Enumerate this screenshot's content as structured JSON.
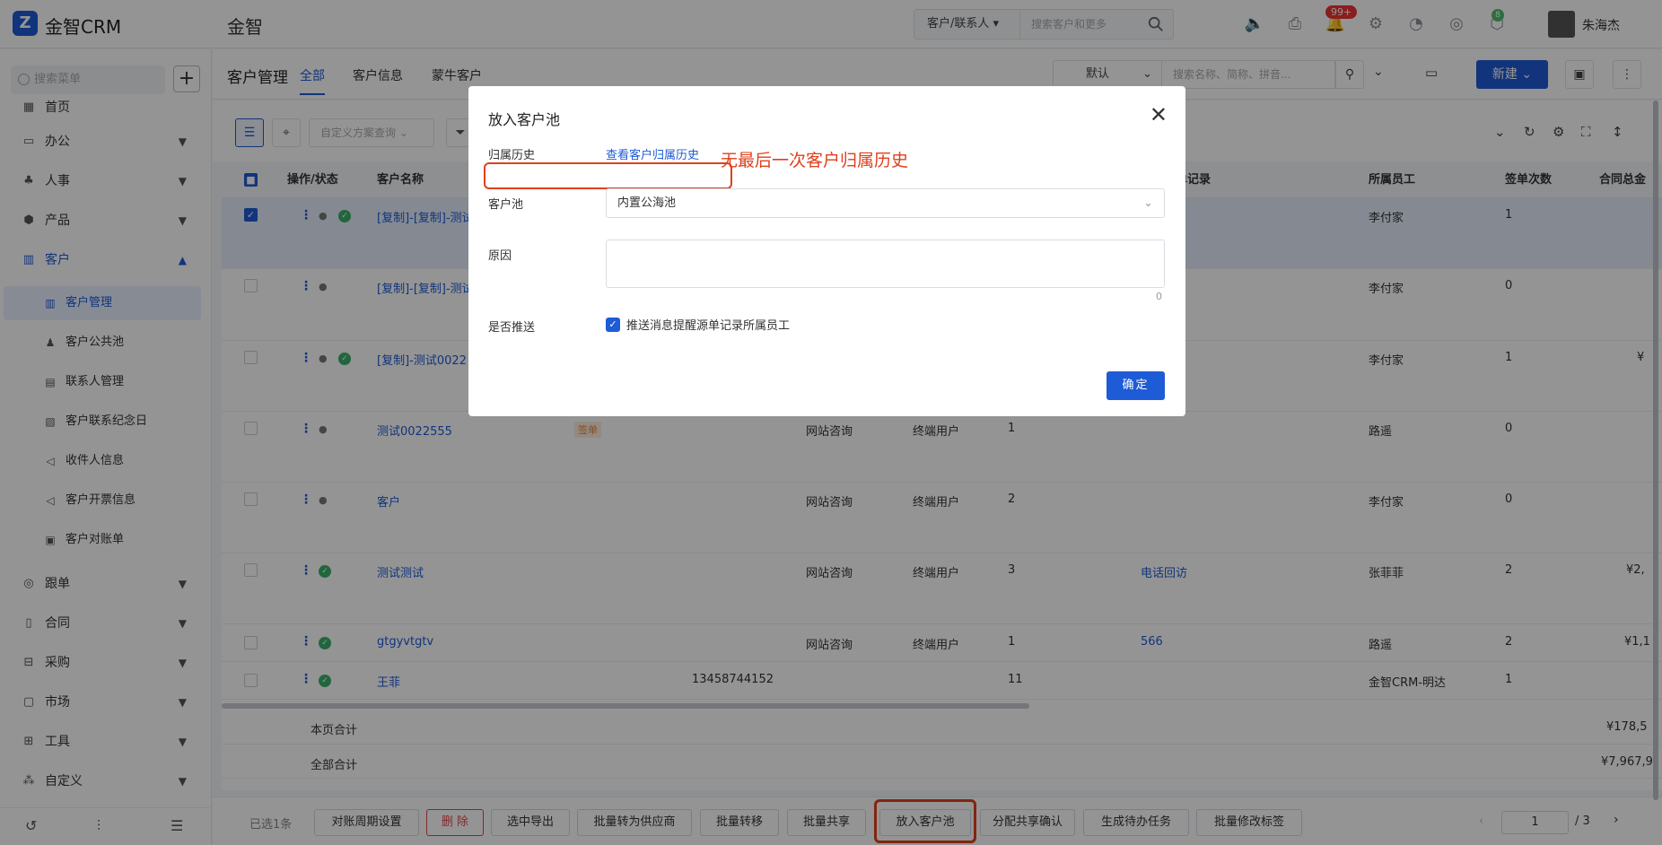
{
  "app": {
    "name": "金智CRM",
    "org": "金智"
  },
  "topsearch": {
    "type": "客户/联系人",
    "placeholder": "搜索客户和更多"
  },
  "notifications": {
    "badge": "99+",
    "green_badge": "8"
  },
  "user": {
    "name": "朱海杰"
  },
  "sidebar": {
    "search_placeholder": "搜索菜单",
    "menu": [
      {
        "label": "首页"
      },
      {
        "label": "办公"
      },
      {
        "label": "人事"
      },
      {
        "label": "产品"
      },
      {
        "label": "客户"
      }
    ],
    "sub": [
      {
        "label": "客户管理"
      },
      {
        "label": "客户公共池"
      },
      {
        "label": "联系人管理"
      },
      {
        "label": "客户联系纪念日"
      },
      {
        "label": "收件人信息"
      },
      {
        "label": "客户开票信息"
      },
      {
        "label": "客户对账单"
      }
    ],
    "menu2": [
      {
        "label": "跟单"
      },
      {
        "label": "合同"
      },
      {
        "label": "采购"
      },
      {
        "label": "市场"
      },
      {
        "label": "工具"
      },
      {
        "label": "自定义"
      }
    ]
  },
  "page": {
    "title": "客户管理",
    "tabs": [
      "全部",
      "客户信息",
      "蒙牛客户"
    ],
    "view": "默认",
    "search_placeholder": "搜索名称、简称、拼音...",
    "new_label": "新建",
    "scheme_placeholder": "自定义方案查询"
  },
  "table": {
    "headers": {
      "op": "操作/状态",
      "name": "客户名称",
      "record": "单记录",
      "employee": "所属员工",
      "count": "签单次数",
      "amount": "合同总金"
    },
    "rows": [
      {
        "name": "[复制]-[复制]-测试",
        "employee": "李付家",
        "count": "1",
        "amount": ""
      },
      {
        "name": "[复制]-[复制]-测试",
        "employee": "李付家",
        "count": "0",
        "amount": ""
      },
      {
        "name": "[复制]-测试0022",
        "employee": "李付家",
        "count": "1",
        "amount": "¥"
      },
      {
        "name": "测试0022555",
        "tag": "签单",
        "source": "网站咨询",
        "type": "终端用户",
        "num": "1",
        "employee": "路遥",
        "count": "0",
        "amount": ""
      },
      {
        "name": "客户",
        "source": "网站咨询",
        "type": "终端用户",
        "num": "2",
        "employee": "李付家",
        "count": "0",
        "amount": ""
      },
      {
        "name": "测试测试",
        "source": "网站咨询",
        "type": "终端用户",
        "num": "3",
        "record": "电话回访",
        "employee": "张菲菲",
        "count": "2",
        "amount": "¥2,"
      },
      {
        "name": "gtgyvtgtv",
        "source": "网站咨询",
        "type": "终端用户",
        "num": "1",
        "record": "566",
        "employee": "路遥",
        "count": "2",
        "amount": "¥1,1"
      },
      {
        "name": "王菲",
        "phone": "13458744152",
        "num": "11",
        "employee": "金智CRM-明达",
        "count": "1",
        "amount": ""
      }
    ],
    "sum_page": {
      "label": "本页合计",
      "amount": "¥178,5"
    },
    "sum_all": {
      "label": "全部合计",
      "amount": "¥7,967,9"
    }
  },
  "footer": {
    "selected": "已选1条",
    "buttons": [
      "对账周期设置",
      "删 除",
      "选中导出",
      "批量转为供应商",
      "批量转移",
      "批量共享",
      "放入客户池",
      "分配共享确认",
      "生成待办任务",
      "批量修改标签"
    ],
    "page": "1",
    "total": "/ 3"
  },
  "modal": {
    "title": "放入客户池",
    "history_label": "归属历史",
    "history_link": "查看客户归属历史",
    "annotation": "无最后一次客户归属历史",
    "pool_label": "客户池",
    "pool_value": "内置公海池",
    "reason_label": "原因",
    "reason_count": "0",
    "push_label": "是否推送",
    "push_text": "推送消息提醒源单记录所属员工",
    "ok": "确定"
  },
  "colors": {
    "primary": "#1e5bd6",
    "highlight": "#e0401c"
  }
}
